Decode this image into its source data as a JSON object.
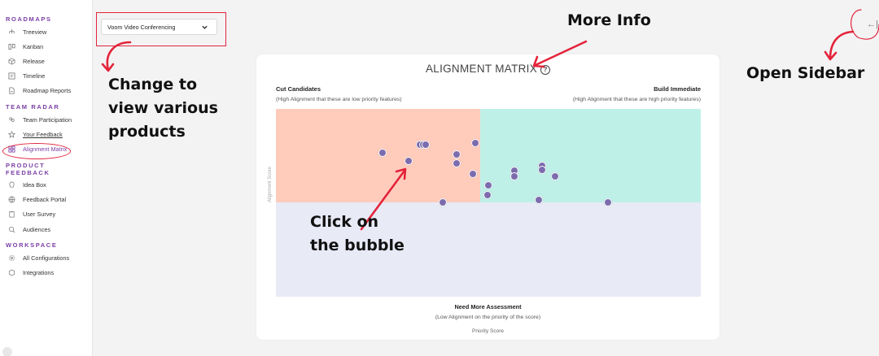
{
  "sidebar": {
    "sections": [
      {
        "title": "ROADMAPS",
        "items": [
          {
            "label": "Treeview",
            "icon": "treeview-icon"
          },
          {
            "label": "Kanban",
            "icon": "kanban-icon"
          },
          {
            "label": "Release",
            "icon": "release-icon"
          },
          {
            "label": "Timeline",
            "icon": "timeline-icon"
          },
          {
            "label": "Roadmap Reports",
            "icon": "report-icon"
          }
        ]
      },
      {
        "title": "TEAM RADAR",
        "items": [
          {
            "label": "Team Participation",
            "icon": "team-icon"
          },
          {
            "label": "Your Feedback",
            "icon": "star-icon"
          },
          {
            "label": "Alignment Matrix",
            "icon": "grid-icon",
            "active": true
          }
        ]
      },
      {
        "title": "PRODUCT FEEDBACK",
        "items": [
          {
            "label": "Idea Box",
            "icon": "lightbulb-icon"
          },
          {
            "label": "Feedback Portal",
            "icon": "globe-icon"
          },
          {
            "label": "User Survey",
            "icon": "clipboard-icon"
          },
          {
            "label": "Audiences",
            "icon": "audience-icon"
          }
        ]
      },
      {
        "title": "WORKSPACE",
        "items": [
          {
            "label": "All Configurations",
            "icon": "gear-icon"
          },
          {
            "label": "Integrations",
            "icon": "integrations-icon"
          }
        ]
      }
    ]
  },
  "product_selector": {
    "value": "Voom Video Conferencing"
  },
  "card": {
    "title": "ALIGNMENT MATRIX",
    "help_glyph": "?",
    "top_left_title": "Cut Candidates",
    "top_left_sub": "(High Alignment that these are low priority features)",
    "top_right_title": "Build Immediate",
    "top_right_sub": "(High Alignment that these are high priority features)",
    "bottom_title": "Need More Assessment",
    "bottom_sub": "(Low Alignment on the priority of the score)",
    "x_axis": "Priority Score",
    "y_axis": "Alignment Score"
  },
  "annotations": {
    "change": [
      "Change to",
      "view various",
      "products"
    ],
    "more_info": "More Info",
    "open_sidebar": "Open Sidebar",
    "click": [
      "Click on",
      "the bubble"
    ],
    "arrow_color": "#e3243b"
  },
  "collapse_glyph": "←|",
  "colors": {
    "brand": "#7b3fa6",
    "cut": "#ffccbc",
    "build": "#bff0e8",
    "assess": "#e8eaf6",
    "bubble": "#7c6cae"
  }
}
